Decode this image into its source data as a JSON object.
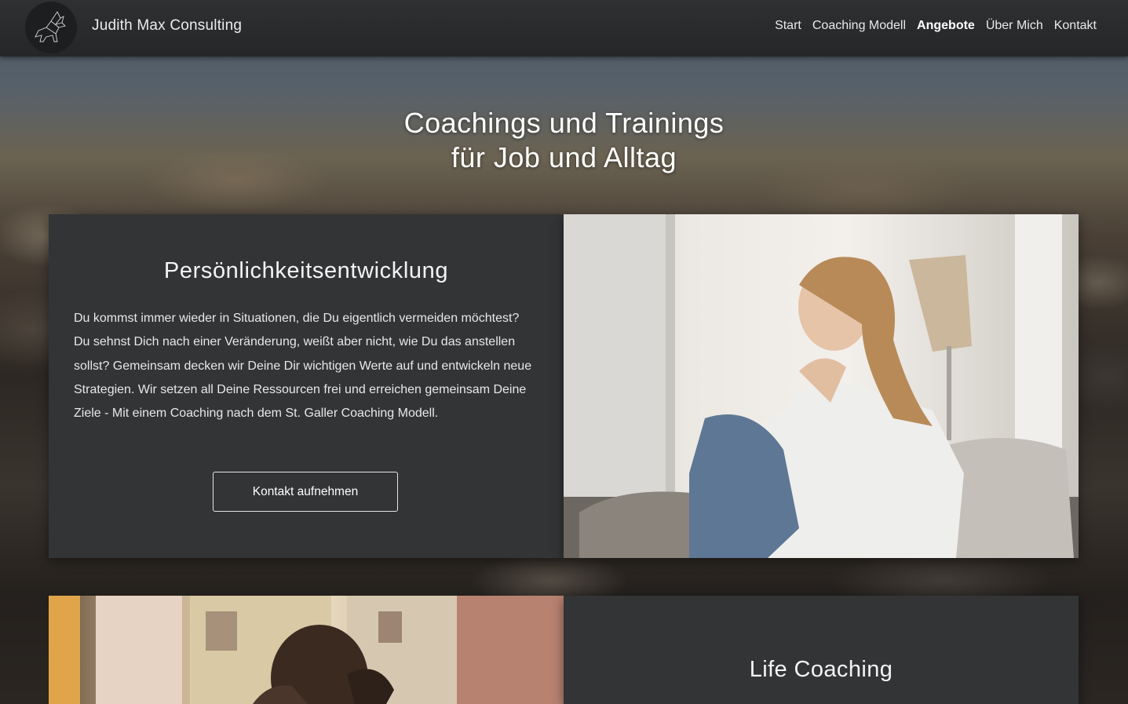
{
  "header": {
    "brand": "Judith Max Consulting",
    "logo_icon": "wolf-logo-icon",
    "nav": [
      {
        "label": "Start",
        "active": false
      },
      {
        "label": "Coaching Modell",
        "active": false
      },
      {
        "label": "Angebote",
        "active": true
      },
      {
        "label": "Über Mich",
        "active": false
      },
      {
        "label": "Kontakt",
        "active": false
      }
    ]
  },
  "hero": {
    "title_line1": "Coachings und Trainings",
    "title_line2": "für Job und Alltag"
  },
  "sections": [
    {
      "title": "Persönlichkeitsentwicklung",
      "text": "Du kommst immer wieder in Situationen, die Du eigentlich vermeiden möchtest? Du sehnst Dich nach einer Veränderung, weißt aber nicht, wie Du das anstellen sollst? Gemeinsam decken wir Deine Dir wichtigen Werte auf und entwickeln neue Strategien. Wir setzen all Deine Ressourcen frei und erreichen gemeinsam Deine Ziele - Mit einem Coaching nach dem St. Galler Coaching Modell.",
      "button": "Kontakt aufnehmen",
      "image": "woman-sitting-on-sofa-photo"
    },
    {
      "title": "Life Coaching",
      "image": "man-holding-head-photo"
    }
  ],
  "colors": {
    "card_bg": "#333436",
    "topbar_bg": "#2a2b2d",
    "text": "#f2f2f2"
  }
}
